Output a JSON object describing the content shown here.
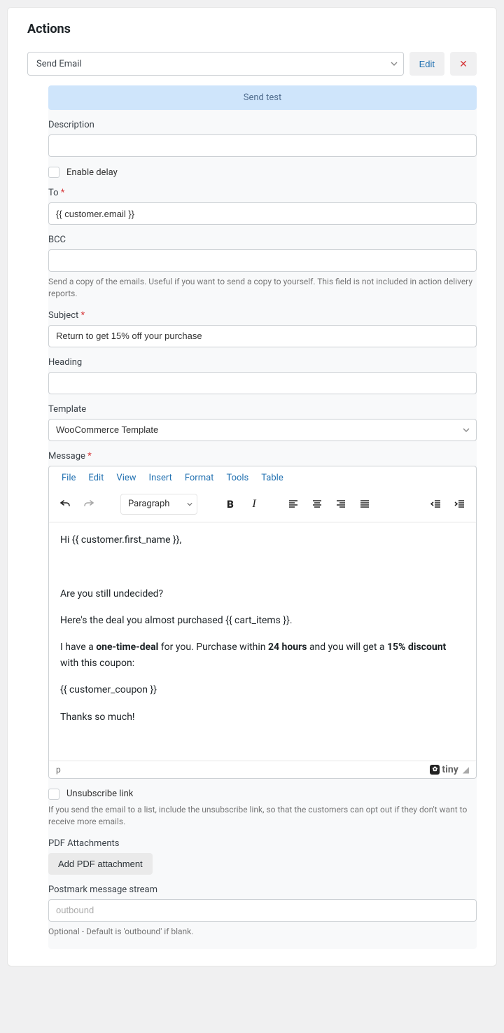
{
  "header": {
    "title": "Actions",
    "action_type": "Send Email",
    "edit_label": "Edit"
  },
  "send_test_label": "Send test",
  "fields": {
    "description": {
      "label": "Description",
      "value": ""
    },
    "enable_delay_label": "Enable delay",
    "to": {
      "label": "To",
      "value": "{{ customer.email }}"
    },
    "bcc": {
      "label": "BCC",
      "value": "",
      "help": "Send a copy of the emails. Useful if you want to send a copy to yourself. This field is not included in action delivery reports."
    },
    "subject": {
      "label": "Subject",
      "value": "Return to get 15% off your purchase"
    },
    "heading": {
      "label": "Heading",
      "value": ""
    },
    "template": {
      "label": "Template",
      "value": "WooCommerce Template"
    },
    "message_label": "Message",
    "unsubscribe": {
      "label": "Unsubscribe link",
      "help": "If you send the email to a list, include the unsubscribe link, so that the customers can opt out if they don't want to receive more emails."
    },
    "pdf": {
      "label": "PDF Attachments",
      "button": "Add PDF attachment"
    },
    "postmark": {
      "label": "Postmark message stream",
      "placeholder": "outbound",
      "help": "Optional - Default is 'outbound' if blank."
    }
  },
  "editor": {
    "menu": [
      "File",
      "Edit",
      "View",
      "Insert",
      "Format",
      "Tools",
      "Table"
    ],
    "block_format": "Paragraph",
    "path": "p",
    "brand": "tiny",
    "content": {
      "p1_a": "Hi ",
      "p1_b": "{{ customer.first_name }}",
      "p1_c": ",",
      "p2": "Are you still undecided?",
      "p3_a": "Here's the deal you almost purchased ",
      "p3_b": "{{ cart_items }}",
      "p3_c": ".",
      "p4_a": "I have a ",
      "p4_b": "one-time-deal",
      "p4_c": " for you. Purchase within ",
      "p4_d": "24 hours",
      "p4_e": " and you will get a ",
      "p4_f": "15% discount",
      "p4_g": " with this coupon:",
      "p5": "{{ customer_coupon }}",
      "p6": "Thanks so much!"
    }
  }
}
